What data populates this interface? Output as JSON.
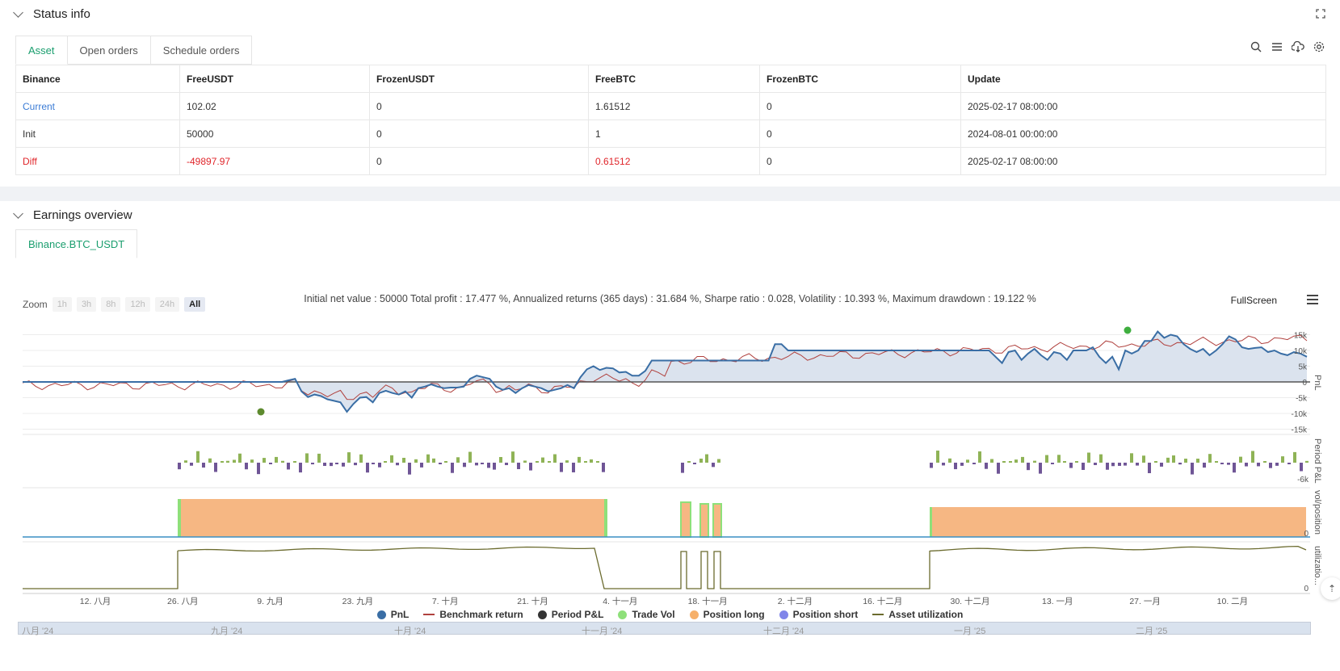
{
  "status": {
    "title": "Status info",
    "tabs": [
      "Asset",
      "Open orders",
      "Schedule orders"
    ],
    "table": {
      "headers": [
        "Binance",
        "FreeUSDT",
        "FrozenUSDT",
        "FreeBTC",
        "FrozenBTC",
        "Update"
      ],
      "rows": [
        [
          "Current",
          "102.02",
          "0",
          "1.61512",
          "0",
          "2025-02-17 08:00:00"
        ],
        [
          "Init",
          "50000",
          "0",
          "1",
          "0",
          "2024-08-01 00:00:00"
        ],
        [
          "Diff",
          "-49897.97",
          "0",
          "0.61512",
          "0",
          "2025-02-17 08:00:00"
        ]
      ]
    }
  },
  "earnings": {
    "title": "Earnings overview",
    "tab": "Binance.BTC_USDT",
    "summary": "Initial net value : 50000 Total profit : 17.477 %, Annualized returns (365 days) : 31.684 %, Sharpe ratio : 0.028, Volatility : 10.393 %, Maximum drawdown : 19.122 %",
    "fullscreen": "FullScreen",
    "zoom_label": "Zoom",
    "zoom_buttons": [
      "1h",
      "3h",
      "8h",
      "12h",
      "24h",
      "All"
    ],
    "legend": [
      "PnL",
      "Benchmark return",
      "Period P&L",
      "Trade Vol",
      "Position long",
      "Position short",
      "Asset utilization"
    ],
    "navigator_labels": [
      "八月 '24",
      "九月 '24",
      "十月 '24",
      "十一月 '24",
      "十二月 '24",
      "一月 '25",
      "二月 '25"
    ]
  },
  "colors": {
    "pnl": "#3a6ea5",
    "benchmark": "#b0413e",
    "period_pos": "#8fb356",
    "period_neg": "#6f5596",
    "position_long": "#f6b783",
    "trade_vol": "#8ee07a",
    "position_short": "#8085e9",
    "utilization": "#6b6b2e",
    "accent": "#1a9e6e"
  },
  "chart_data": {
    "type": "line",
    "x_ticks": [
      "12. 八月",
      "26. 八月",
      "9. 九月",
      "23. 九月",
      "7. 十月",
      "21. 十月",
      "4. 十一月",
      "18. 十一月",
      "2. 十二月",
      "16. 十二月",
      "30. 十二月",
      "13. 一月",
      "27. 一月",
      "10. 二月"
    ],
    "pnl_axis": {
      "label": "PnL",
      "ticks": [
        "15k",
        "10k",
        "5k",
        "0",
        "-5k",
        "-10k",
        "-15k"
      ],
      "ylim": [
        -15000,
        15000
      ]
    },
    "period_axis": {
      "label": "Period P&L",
      "ticks": [
        "-6k"
      ]
    },
    "position_axis": {
      "label": "vol/position",
      "ticks": [
        "0"
      ]
    },
    "utilization_axis": {
      "label": "utilizatio...",
      "ticks": [
        "0"
      ]
    },
    "pnl_series": [
      0,
      0,
      0,
      0,
      0,
      0,
      0,
      0,
      0,
      0,
      0,
      0,
      0,
      0,
      0,
      0,
      0,
      0,
      0,
      0,
      0,
      0,
      0,
      0,
      0,
      0,
      0,
      0,
      0,
      0,
      0,
      0,
      0,
      0,
      0,
      0,
      0,
      0,
      0,
      0,
      0,
      500,
      1000,
      -3000,
      -4800,
      -4000,
      -4500,
      -5500,
      -6000,
      -6500,
      -9500,
      -7000,
      -5000,
      -4800,
      -6500,
      -3500,
      -2800,
      -3500,
      -4000,
      -3000,
      -5000,
      -2000,
      -1500,
      -800,
      -1500,
      -2000,
      -1800,
      -1800,
      -1500,
      1000,
      2000,
      1500,
      1000,
      -1500,
      -2500,
      -2000,
      -3500,
      -2000,
      -1000,
      -1500,
      -2000,
      -3000,
      -2500,
      -2000,
      -1000,
      -2000,
      1500,
      4000,
      5000,
      3800,
      4500,
      4300,
      3000,
      3200,
      2000,
      2000,
      3500,
      6800,
      6800,
      6800,
      6800,
      6800,
      6800,
      6800,
      6800,
      6800,
      6800,
      6800,
      6800,
      6800,
      6800,
      6800,
      6800,
      6800,
      6800,
      6800,
      12000,
      12000,
      10000,
      10000,
      10000,
      10000,
      10000,
      10000,
      10000,
      10000,
      10000,
      10000,
      10000,
      10000,
      10000,
      10000,
      10000,
      10000,
      10000,
      10000,
      10000,
      10000,
      10000,
      10000,
      10000,
      10000,
      10000,
      10000,
      10000,
      10000,
      10000,
      10000,
      10000,
      10000,
      8000,
      6000,
      9500,
      10000,
      7000,
      9000,
      10500,
      8500,
      7000,
      9500,
      9000,
      7000,
      10000,
      10000,
      10000,
      11000,
      8000,
      6000,
      8000,
      4000,
      10000,
      9000,
      10000,
      13000,
      13000,
      16000,
      14000,
      15000,
      14500,
      12000,
      10500,
      9500,
      10500,
      8500,
      10000,
      12000,
      14500,
      13500,
      11000,
      10500,
      10800,
      11000,
      9500,
      10000,
      9000,
      8500,
      9500,
      9000,
      8000
    ]
  }
}
